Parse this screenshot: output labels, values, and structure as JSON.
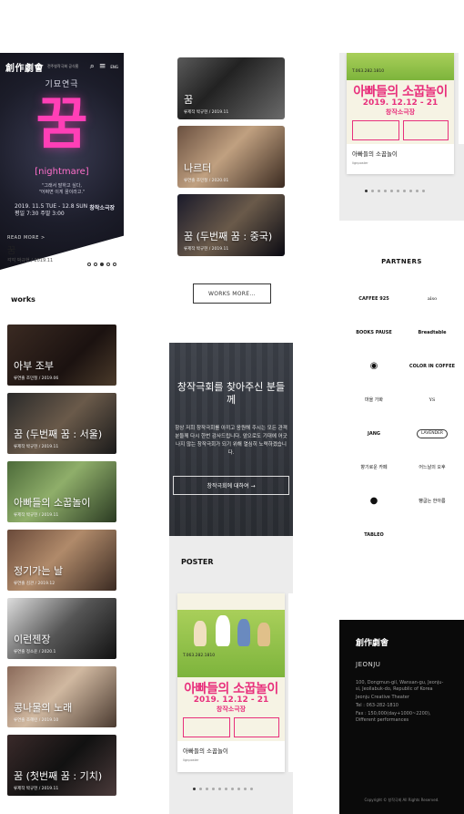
{
  "header": {
    "logo": "創作劇會",
    "logo_sub": "전주창작극회 공식홈",
    "search_icon": "⌕",
    "menu_icon": "≡",
    "lang_icon": "ENG"
  },
  "hero": {
    "genre": "기묘연극",
    "big_title": "꿈",
    "eng_title": "[nightmare]",
    "quote_1": "\"그래서 말하고 싶다,",
    "quote_2": "\"어쩌면 이게 꿈이라고.\"",
    "date_line1": "2019. 11.5 TUE - 12.8 SUN",
    "date_line2": "평일 7:30 주말 3:00",
    "venue": "창작소극장",
    "read_more": "READ MORE  >",
    "caption_title": "꿈",
    "caption_meta": "각각 박규현 / 2019.11",
    "slider_total": 5,
    "slider_active": 2
  },
  "works": {
    "label": "works",
    "items": [
      {
        "title": "아부 조부",
        "meta": "류연출 조민철 / 2019.06",
        "bg": "linear-gradient(135deg,#3a2a22 0%,#1b1210 60%,#4a3a2a 100%)"
      },
      {
        "title": "꿈 (두번째 꿈 : 서울)",
        "meta": "류제작 박규현 / 2019.11",
        "bg": "linear-gradient(135deg,#2a2a2a 0%,#6a5a4a 50%,#1a1a1a 100%)"
      },
      {
        "title": "아빠들의 소꿉놀이",
        "meta": "류제작 박규현 / 2019.11",
        "bg": "linear-gradient(135deg,#4d6b3a 0%,#8fae6a 45%,#2a3a22 100%)"
      },
      {
        "title": "정기가는 날",
        "meta": "류연출 김관 / 2019.12",
        "bg": "linear-gradient(135deg,#6a4a3a 0%,#b08a6a 45%,#3a2a22 100%)"
      },
      {
        "title": "이런젠장",
        "meta": "류연출 정소윤 / 2020.1",
        "bg": "linear-gradient(135deg,#ddd 0%,#555 50%,#111 100%)"
      },
      {
        "title": "콩나물의 노래",
        "meta": "류연출 조혜련 / 2019.10",
        "bg": "linear-gradient(135deg,#8a6a5a 0%,#d0b8a0 45%,#4a3a30 100%)"
      },
      {
        "title": "꿈 (첫번째 꿈 : 기치)",
        "meta": "류제작 박규현 / 2019.11",
        "bg": "linear-gradient(135deg,#3a2a2a 0%,#111 50%,#4a3a3a 100%)"
      }
    ]
  },
  "works2": {
    "items": [
      {
        "title": "꿈",
        "meta": "류제작 박규현 / 2019.11",
        "bg": "linear-gradient(135deg,#5a5a5a 0%,#222 40%,#6a6a6a 100%)"
      },
      {
        "title": "나르터",
        "meta": "류연출 조민철 / 2020.01",
        "bg": "linear-gradient(135deg,#6a5040 0%,#c0a080 45%,#3a2a20 100%)"
      },
      {
        "title": "꿈 (두번째 꿈 : 중국)",
        "meta": "류제작 박규현 / 2019.11",
        "bg": "linear-gradient(135deg,#1a1a2a 0%,#6a5a4a 50%,#0a0a12 100%)"
      }
    ],
    "more_label": "WORKS MORE..."
  },
  "banner": {
    "title": "창작극회를 찾아주신 분들께",
    "text": "항상 저희 창작극회를 아끼고 응원해 주시는 모든 관객분들께 다시 한번 감사드립니다. 앞으로도 기대에 어긋나지 않는 창작극회가 되기 위해 열심히 노력하겠습니다.",
    "button": "창작극회에 대하여 →"
  },
  "poster": {
    "label": "POSTER",
    "card_title": "아빠들의 소꿉놀이",
    "brand": "lignposter",
    "art_title": "아빠들의 소꿉놀이",
    "art_date": "2019. 12.12 - 21",
    "art_venue": "창작소극장",
    "phone": "T.063.282.1810",
    "slider_total": 10,
    "slider_active": 0
  },
  "partners": {
    "label": "PARTNERS",
    "logos": [
      {
        "name": "CAFFEE 925",
        "style": "bold"
      },
      {
        "name": "also",
        "style": "serif"
      },
      {
        "name": "BOOKS PAUSE",
        "style": "bold"
      },
      {
        "name": "Breadtable",
        "style": "bold"
      },
      {
        "name": "◉",
        "style": "circle"
      },
      {
        "name": "COLOR IN COFFEE",
        "style": "bold"
      },
      {
        "name": "마을 가화",
        "style": "serif"
      },
      {
        "name": "YS",
        "style": "serif"
      },
      {
        "name": "JANG",
        "style": "bold"
      },
      {
        "name": "LAVENDER",
        "style": "box"
      },
      {
        "name": "향기로운 카페",
        "style": "plain"
      },
      {
        "name": "어느날의 오후",
        "style": "plain"
      },
      {
        "name": "●",
        "style": "circle"
      },
      {
        "name": "빵굽는 한아름",
        "style": "serif"
      },
      {
        "name": "TABLEO",
        "style": "bold"
      }
    ]
  },
  "footer": {
    "logo": "創作劇會",
    "city": "JEONJU",
    "address": "100, Dongmun-gil, Wansan-gu, Jeonju-si, Jeollabuk-do, Republic of Korea",
    "theater": "Jeonju Creative Theater",
    "tel": "Tel : 063-282-1810",
    "fax": "Fax : 150,000(day+1000~2200), Different performances",
    "copyright": "Copyright © 창작극회 All Rights Reserved."
  },
  "colors": {
    "accent_pink": "#ff3fb6",
    "poster_pink": "#e8307c",
    "footer_bg": "#0a0a0a",
    "section_gray": "#ececec"
  }
}
